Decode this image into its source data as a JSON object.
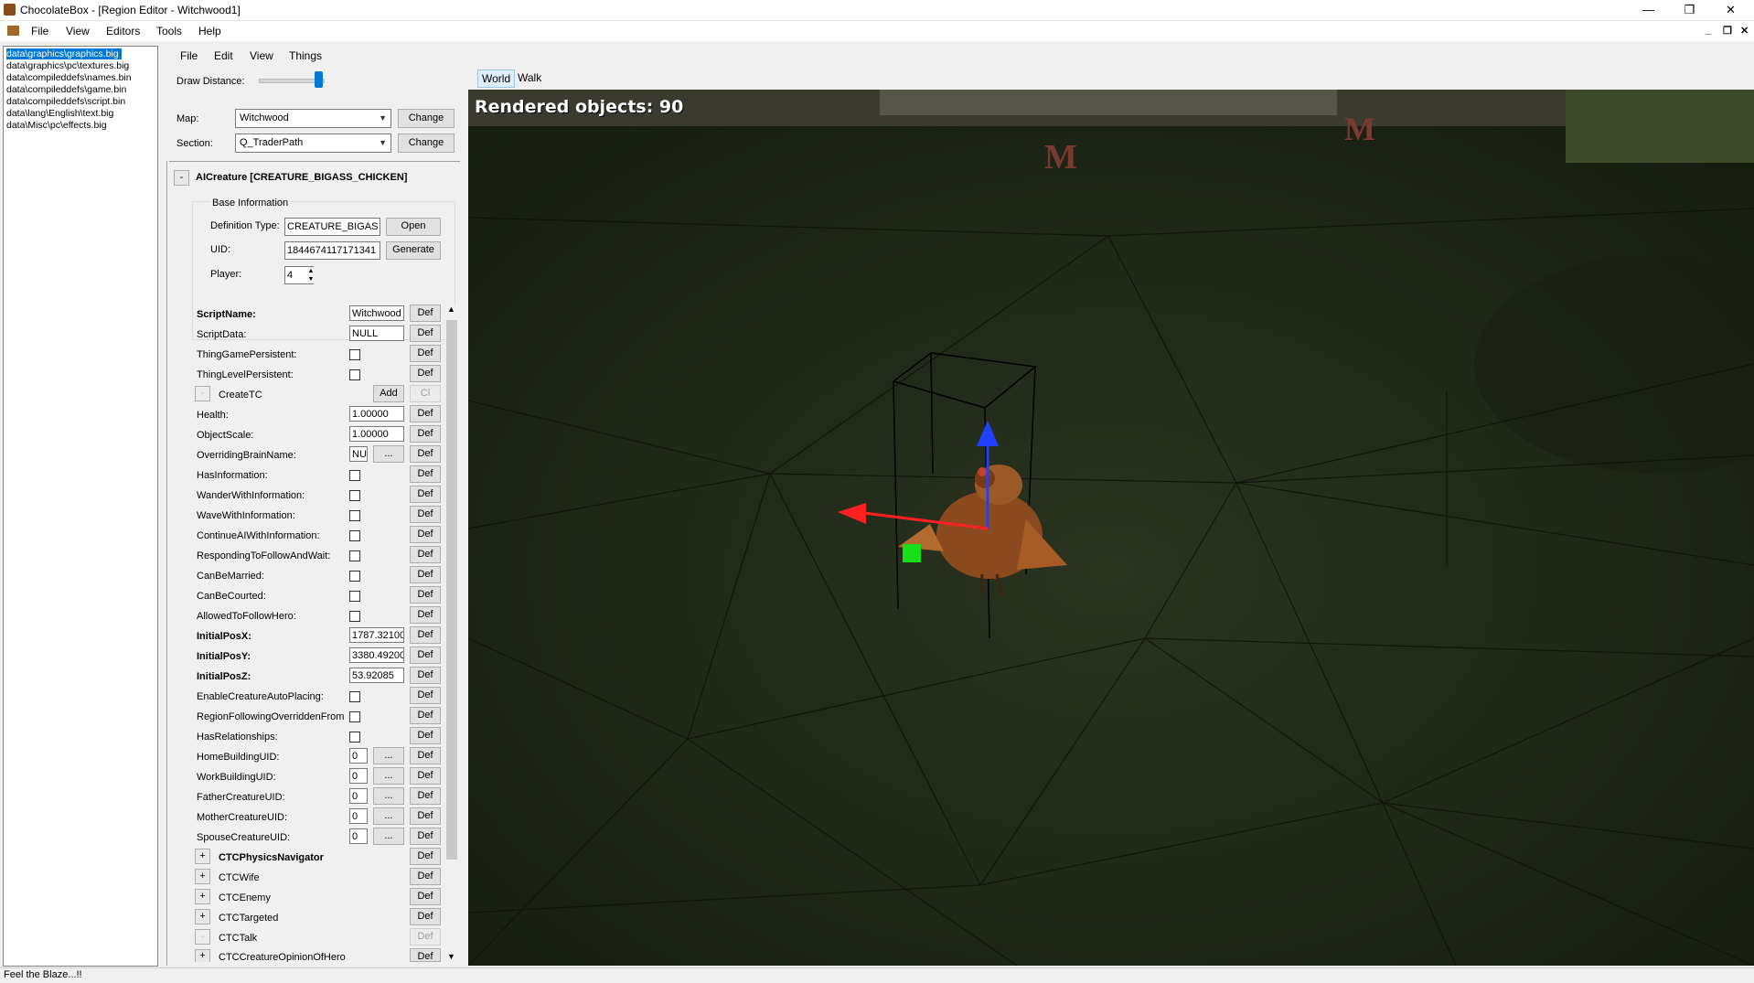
{
  "window": {
    "title": "ChocolateBox - [Region Editor - Witchwood1]",
    "buttons": {
      "minimize": "—",
      "restore": "❐",
      "close": "✕"
    }
  },
  "main_menu": [
    "File",
    "View",
    "Editors",
    "Tools",
    "Help"
  ],
  "mdi_controls": {
    "minimize": "_",
    "restore": "❐",
    "close": "✕"
  },
  "file_list": [
    "data\\graphics\\graphics.big",
    "data\\graphics\\pc\\textures.big",
    "data\\compileddefs\\names.bin",
    "data\\compileddefs\\game.bin",
    "data\\compileddefs\\script.bin",
    "data\\lang\\English\\text.big",
    "data\\Misc\\pc\\effects.big"
  ],
  "editor_menu": [
    "File",
    "Edit",
    "View",
    "Things"
  ],
  "draw_distance": {
    "label": "Draw Distance:",
    "level": 0.93
  },
  "map": {
    "label": "Map:",
    "value": "Witchwood",
    "button": "Change"
  },
  "section": {
    "label": "Section:",
    "value": "Q_TraderPath",
    "button": "Change"
  },
  "thing": {
    "toggle": "-",
    "header": "AICreature [CREATURE_BIGASS_CHICKEN]",
    "base_info": {
      "group": "Base Information",
      "definition_label": "Definition Type:",
      "definition_value": "CREATURE_BIGAS",
      "open_button": "Open",
      "uid_label": "UID:",
      "uid_value": "1844674117171341",
      "generate_button": "Generate",
      "player_label": "Player:",
      "player_value": "4"
    }
  },
  "def_label": "Def",
  "properties": {
    "script_name": {
      "label": "ScriptName:",
      "value": "Witchwood"
    },
    "script_data": {
      "label": "ScriptData:",
      "value": "NULL"
    },
    "thing_game_persistent": {
      "label": "ThingGamePersistent:"
    },
    "thing_level_persistent": {
      "label": "ThingLevelPersistent:"
    },
    "create_tc": {
      "label": "CreateTC",
      "add": "Add",
      "clear": "Cl",
      "toggle": "-"
    },
    "health": {
      "label": "Health:",
      "value": "1.00000"
    },
    "object_scale": {
      "label": "ObjectScale:",
      "value": "1.00000"
    },
    "overriding_brain": {
      "label": "OverridingBrainName:",
      "value": "NU",
      "browse": "..."
    },
    "has_information": {
      "label": "HasInformation:"
    },
    "wander_with_information": {
      "label": "WanderWithInformation:"
    },
    "wave_with_information": {
      "label": "WaveWithInformation:"
    },
    "continue_ai": {
      "label": "ContinueAIWithInformation:"
    },
    "responding_follow": {
      "label": "RespondingToFollowAndWait:"
    },
    "can_be_married": {
      "label": "CanBeMarried:"
    },
    "can_be_courted": {
      "label": "CanBeCourted:"
    },
    "allowed_follow_hero": {
      "label": "AllowedToFollowHero:"
    },
    "initial_pos_x": {
      "label": "InitialPosX:",
      "value": "1787.32100"
    },
    "initial_pos_y": {
      "label": "InitialPosY:",
      "value": "3380.49200"
    },
    "initial_pos_z": {
      "label": "InitialPosZ:",
      "value": "53.92085"
    },
    "enable_auto_placing": {
      "label": "EnableCreatureAutoPlacing:"
    },
    "region_following": {
      "label": "RegionFollowingOverriddenFrom"
    },
    "has_relationships": {
      "label": "HasRelationships:"
    },
    "home_building_uid": {
      "label": "HomeBuildingUID:",
      "value": "0",
      "browse": "..."
    },
    "work_building_uid": {
      "label": "WorkBuildingUID:",
      "value": "0",
      "browse": "..."
    },
    "father_creature_uid": {
      "label": "FatherCreatureUID:",
      "value": "0",
      "browse": "..."
    },
    "mother_creature_uid": {
      "label": "MotherCreatureUID:",
      "value": "0",
      "browse": "..."
    },
    "spouse_creature_uid": {
      "label": "SpouseCreatureUID:",
      "value": "0",
      "browse": "..."
    },
    "ctc_physics_navigator": {
      "label": "CTCPhysicsNavigator",
      "toggle": "+"
    },
    "ctc_wife": {
      "label": "CTCWife",
      "toggle": "+"
    },
    "ctc_enemy": {
      "label": "CTCEnemy",
      "toggle": "+"
    },
    "ctc_targeted": {
      "label": "CTCTargeted",
      "toggle": "+"
    },
    "ctc_talk": {
      "label": "CTCTalk",
      "toggle": "-"
    },
    "ctc_opinion": {
      "label": "CTCCreatureOpinionOfHero",
      "toggle": "+"
    }
  },
  "viewport": {
    "tabs": [
      "World",
      "Walk"
    ],
    "rendered_objects": "Rendered objects: 90",
    "marker_label": "M",
    "colors": {
      "x_axis": "#ff2020",
      "y_axis": "#2040ff",
      "z_handle": "#18e018",
      "ground": "#1e2616"
    }
  },
  "status": "Feel the Blaze...!!"
}
